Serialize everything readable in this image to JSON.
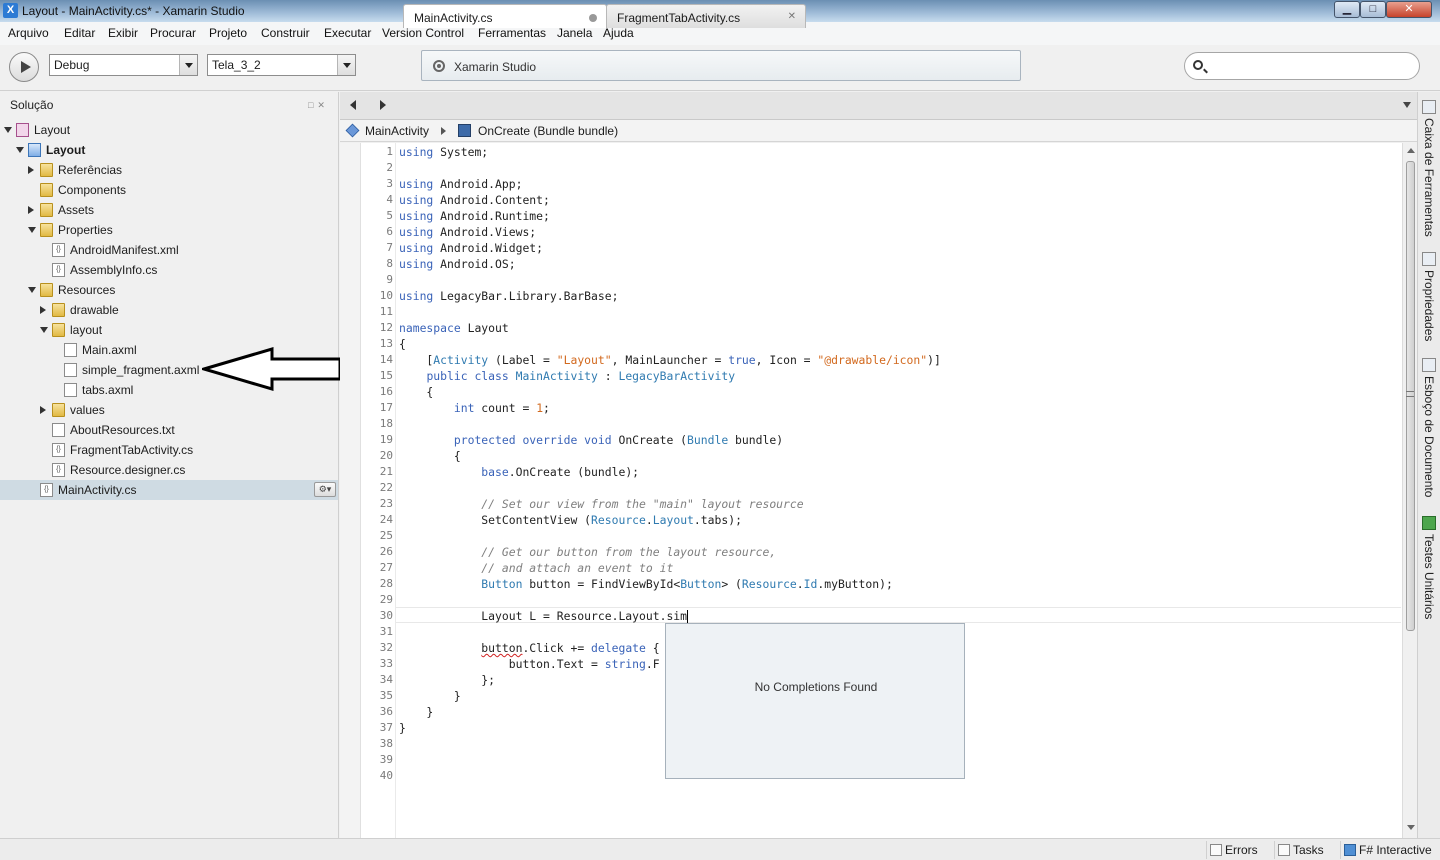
{
  "window": {
    "title": "Layout - MainActivity.cs* - Xamarin Studio",
    "icon_letter": "X",
    "min_glyph": "▁",
    "max_glyph": "□",
    "close_glyph": "✕"
  },
  "menu": [
    "Arquivo",
    "Editar",
    "Exibir",
    "Procurar",
    "Projeto",
    "Construir",
    "Executar",
    "Version Control",
    "Ferramentas",
    "Janela",
    "Ajuda"
  ],
  "toolbar": {
    "configuration": "Debug",
    "target": "Tela_3_2",
    "status_text": "Xamarin Studio",
    "search_placeholder": "",
    "search_value": ""
  },
  "solution_pad": {
    "title": "Solução",
    "pad_buttons": "□✕",
    "gear_glyph": "⚙▾",
    "items": [
      {
        "label": "Layout",
        "level": 0,
        "expander": "open",
        "icon": "sln",
        "bold": false
      },
      {
        "label": "Layout",
        "level": 1,
        "expander": "open",
        "icon": "proj",
        "bold": true
      },
      {
        "label": "Referências",
        "level": 2,
        "expander": "closed",
        "icon": "folder",
        "bold": false
      },
      {
        "label": "Components",
        "level": 2,
        "expander": "none",
        "icon": "folder",
        "bold": false
      },
      {
        "label": "Assets",
        "level": 2,
        "expander": "closed",
        "icon": "folder",
        "bold": false
      },
      {
        "label": "Properties",
        "level": 2,
        "expander": "open",
        "icon": "folder",
        "bold": false
      },
      {
        "label": "AndroidManifest.xml",
        "level": 3,
        "expander": "none",
        "icon": "cs",
        "bold": false
      },
      {
        "label": "AssemblyInfo.cs",
        "level": 3,
        "expander": "none",
        "icon": "cs",
        "bold": false
      },
      {
        "label": "Resources",
        "level": 2,
        "expander": "open",
        "icon": "folder",
        "bold": false
      },
      {
        "label": "drawable",
        "level": 3,
        "expander": "closed",
        "icon": "folder",
        "bold": false
      },
      {
        "label": "layout",
        "level": 3,
        "expander": "open",
        "icon": "folder",
        "bold": false
      },
      {
        "label": "Main.axml",
        "level": 4,
        "expander": "none",
        "icon": "file",
        "bold": false
      },
      {
        "label": "simple_fragment.axml",
        "level": 4,
        "expander": "none",
        "icon": "file",
        "bold": false
      },
      {
        "label": "tabs.axml",
        "level": 4,
        "expander": "none",
        "icon": "file",
        "bold": false
      },
      {
        "label": "values",
        "level": 3,
        "expander": "closed",
        "icon": "folder",
        "bold": false
      },
      {
        "label": "AboutResources.txt",
        "level": 3,
        "expander": "none",
        "icon": "file",
        "bold": false
      },
      {
        "label": "FragmentTabActivity.cs",
        "level": 3,
        "expander": "none",
        "icon": "cs",
        "bold": false
      },
      {
        "label": "Resource.designer.cs",
        "level": 3,
        "expander": "none",
        "icon": "cs",
        "bold": false
      },
      {
        "label": "MainActivity.cs",
        "level": 2,
        "expander": "none",
        "icon": "cs",
        "bold": false,
        "selected": true
      }
    ]
  },
  "tabs": [
    {
      "label": "MainActivity.cs",
      "active": true
    },
    {
      "label": "FragmentTabActivity.cs",
      "active": false,
      "close": "✕"
    }
  ],
  "pathbar": {
    "class": "MainActivity",
    "method": "OnCreate (Bundle bundle)"
  },
  "code": {
    "lines": [
      [
        [
          "kw",
          "using"
        ],
        [
          "t",
          " System;"
        ]
      ],
      [],
      [
        [
          "kw",
          "using"
        ],
        [
          "t",
          " Android.App;"
        ]
      ],
      [
        [
          "kw",
          "using"
        ],
        [
          "t",
          " Android.Content;"
        ]
      ],
      [
        [
          "kw",
          "using"
        ],
        [
          "t",
          " Android.Runtime;"
        ]
      ],
      [
        [
          "kw",
          "using"
        ],
        [
          "t",
          " Android.Views;"
        ]
      ],
      [
        [
          "kw",
          "using"
        ],
        [
          "t",
          " Android.Widget;"
        ]
      ],
      [
        [
          "kw",
          "using"
        ],
        [
          "t",
          " Android.OS;"
        ]
      ],
      [],
      [
        [
          "kw",
          "using"
        ],
        [
          "t",
          " LegacyBar.Library.BarBase;"
        ]
      ],
      [],
      [
        [
          "kw",
          "namespace"
        ],
        [
          "t",
          " Layout"
        ]
      ],
      [
        [
          "t",
          "{"
        ]
      ],
      [
        [
          "t",
          "    ["
        ],
        [
          "ty",
          "Activity"
        ],
        [
          "t",
          " (Label = "
        ],
        [
          "str",
          "\"Layout\""
        ],
        [
          "t",
          ", MainLauncher = "
        ],
        [
          "kw",
          "true"
        ],
        [
          "t",
          ", Icon = "
        ],
        [
          "str",
          "\"@drawable/icon\""
        ],
        [
          "t",
          ")]"
        ]
      ],
      [
        [
          "t",
          "    "
        ],
        [
          "kw",
          "public class"
        ],
        [
          "t",
          " "
        ],
        [
          "ty",
          "MainActivity"
        ],
        [
          "t",
          " : "
        ],
        [
          "ty",
          "LegacyBarActivity"
        ]
      ],
      [
        [
          "t",
          "    {"
        ]
      ],
      [
        [
          "t",
          "        "
        ],
        [
          "kw",
          "int"
        ],
        [
          "t",
          " count = "
        ],
        [
          "str",
          "1"
        ],
        [
          "t",
          ";"
        ]
      ],
      [],
      [
        [
          "t",
          "        "
        ],
        [
          "kw",
          "protected override void"
        ],
        [
          "t",
          " OnCreate ("
        ],
        [
          "ty",
          "Bundle"
        ],
        [
          "t",
          " bundle)"
        ]
      ],
      [
        [
          "t",
          "        {"
        ]
      ],
      [
        [
          "t",
          "            "
        ],
        [
          "kw",
          "base"
        ],
        [
          "t",
          ".OnCreate (bundle);"
        ]
      ],
      [],
      [
        [
          "t",
          "            "
        ],
        [
          "cm",
          "// Set our view from the \"main\" layout resource"
        ]
      ],
      [
        [
          "t",
          "            SetContentView ("
        ],
        [
          "ty",
          "Resource"
        ],
        [
          "t",
          "."
        ],
        [
          "ty",
          "Layout"
        ],
        [
          "t",
          ".tabs);"
        ]
      ],
      [],
      [
        [
          "t",
          "            "
        ],
        [
          "cm",
          "// Get our button from the layout resource,"
        ]
      ],
      [
        [
          "t",
          "            "
        ],
        [
          "cm",
          "// and attach an event to it"
        ]
      ],
      [
        [
          "t",
          "            "
        ],
        [
          "ty",
          "Button"
        ],
        [
          "t",
          " button = FindViewById<"
        ],
        [
          "ty",
          "Button"
        ],
        [
          "t",
          "> ("
        ],
        [
          "ty",
          "Resource"
        ],
        [
          "t",
          "."
        ],
        [
          "ty",
          "Id"
        ],
        [
          "t",
          ".myButton);"
        ]
      ],
      [],
      [
        [
          "t",
          "            Layout L = Resource.Layout.sim"
        ],
        [
          "caret",
          ""
        ]
      ],
      [],
      [
        [
          "t",
          "            "
        ],
        [
          "sq",
          "button"
        ],
        [
          "t",
          ".Click += "
        ],
        [
          "kw",
          "delegate"
        ],
        [
          "t",
          " {"
        ]
      ],
      [
        [
          "t",
          "                button.Text = "
        ],
        [
          "kw",
          "string"
        ],
        [
          "t",
          ".F"
        ]
      ],
      [
        [
          "t",
          "            };"
        ]
      ],
      [
        [
          "t",
          "        }"
        ]
      ],
      [
        [
          "t",
          "    }"
        ]
      ],
      [
        [
          "t",
          "}"
        ]
      ],
      [],
      [],
      []
    ]
  },
  "completion": {
    "message": "No Completions Found"
  },
  "right_dock": [
    "Caixa de Ferramentas",
    "Propriedades",
    "Esboço de Documento",
    "Testes Unitários"
  ],
  "statusbar": {
    "errors": "Errors",
    "tasks": "Tasks",
    "fsharp": "F# Interactive"
  }
}
